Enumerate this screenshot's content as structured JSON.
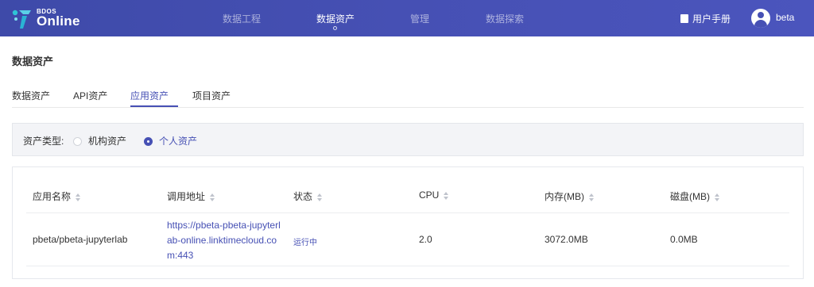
{
  "brand": {
    "small": "BDOS",
    "big": "Online"
  },
  "nav": {
    "items": [
      {
        "label": "数据工程"
      },
      {
        "label": "数据资产"
      },
      {
        "label": "管理"
      },
      {
        "label": "数据探索"
      }
    ],
    "active_index": 1
  },
  "user_menu": {
    "manual_label": "用户手册",
    "username": "beta"
  },
  "page": {
    "title": "数据资产"
  },
  "tabs": {
    "items": [
      {
        "label": "数据资产"
      },
      {
        "label": "API资产"
      },
      {
        "label": "应用资产"
      },
      {
        "label": "项目资产"
      }
    ],
    "active_index": 2
  },
  "filter": {
    "label": "资产类型:",
    "options": [
      {
        "label": "机构资产",
        "checked": false
      },
      {
        "label": "个人资产",
        "checked": true
      }
    ]
  },
  "table": {
    "columns": [
      "应用名称",
      "调用地址",
      "状态",
      "CPU",
      "内存(MB)",
      "磁盘(MB)"
    ],
    "rows": [
      {
        "name": "pbeta/pbeta-jupyterlab",
        "url": "https://pbeta-pbeta-jupyterlab-online.linktimecloud.com:443",
        "status": "运行中",
        "cpu": "2.0",
        "memory": "3072.0MB",
        "disk": "0.0MB"
      }
    ]
  },
  "colors": {
    "accent": "#4650b4",
    "header_bg": "#4650b4"
  }
}
